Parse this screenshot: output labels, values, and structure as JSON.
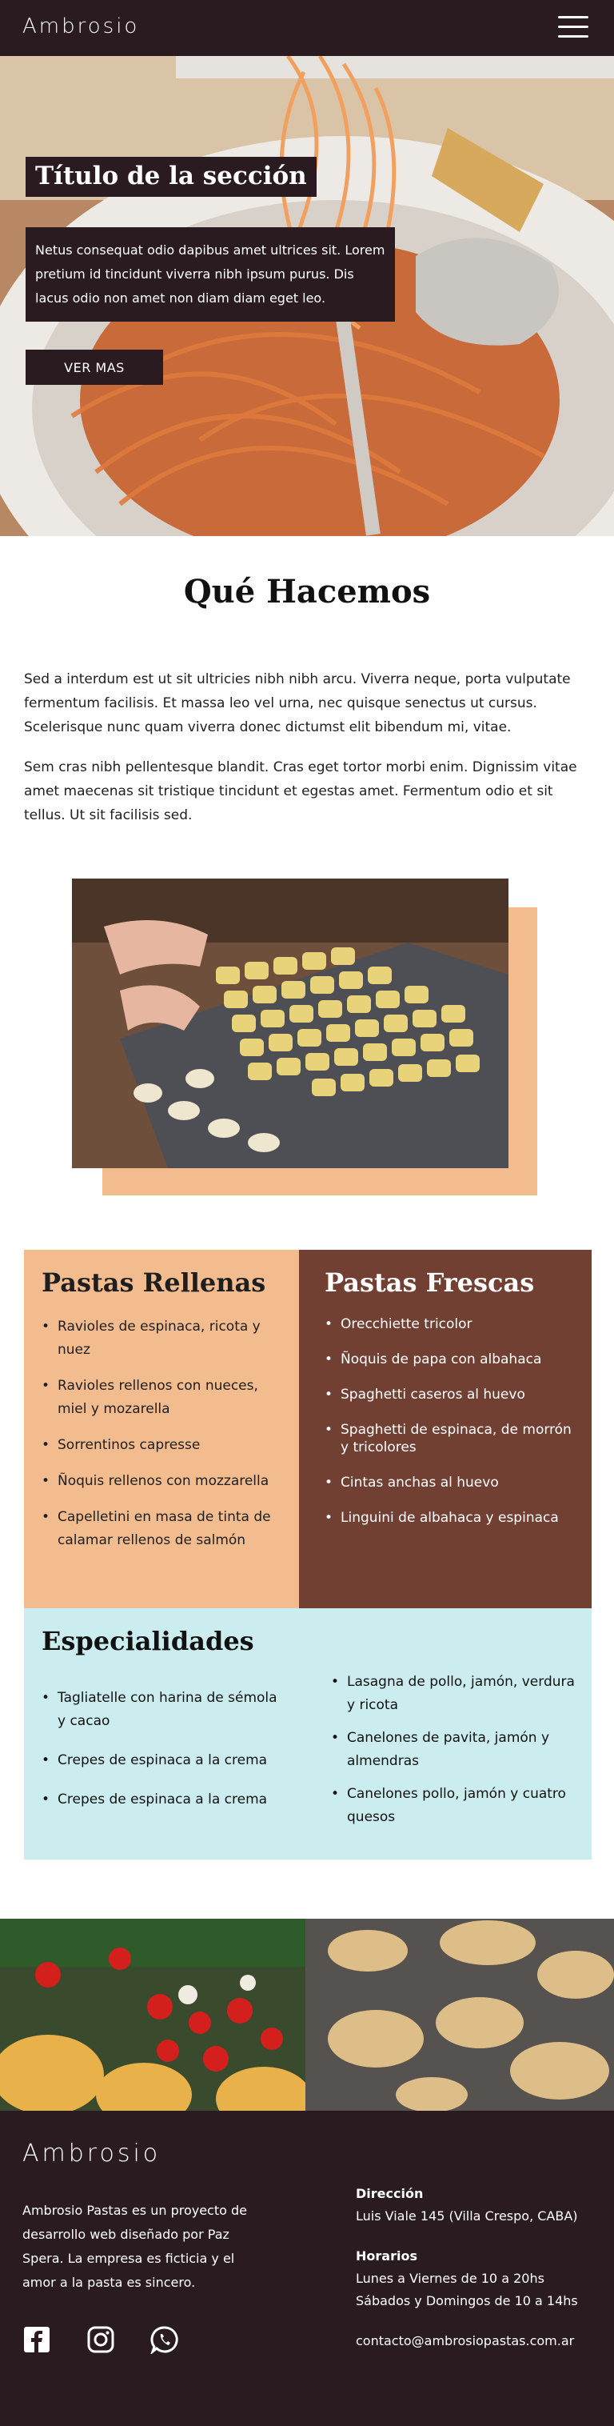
{
  "header": {
    "logo": "Ambrosio",
    "menu_icon": "hamburger-menu-icon"
  },
  "hero": {
    "title": "Título de la sección",
    "text": "Netus consequat odio dapibus amet ultrices sit. Lorem pretium id tincidunt viverra nibh ipsum purus. Dis lacus odio non amet non diam diam eget leo.",
    "button": "VER MAS"
  },
  "about": {
    "title": "Qué Hacemos",
    "p1": "Sed a interdum est ut sit ultricies nibh nibh arcu. Viverra neque, porta vulputate fermentum facilisis. Et massa leo vel urna, nec quisque senectus ut cursus. Scelerisque nunc quam viverra donec dictumst elit bibendum mi, vitae.",
    "p2": "Sem cras nibh pellentesque blandit. Cras eget tortor morbi enim. Dignissim vitae amet maecenas sit tristique tincidunt et egestas amet. Fermentum odio et sit tellus. Ut sit facilisis sed."
  },
  "rellenas": {
    "title": "Pastas Rellenas",
    "items": [
      "Ravioles de espinaca, ricota y nuez",
      "Ravioles rellenos con nueces, miel y mozarella",
      "Sorrentinos capresse",
      "Ñoquis  rellenos con mozzarella",
      "Capelletini en masa de tinta de calamar rellenos de salmón"
    ]
  },
  "frescas": {
    "title": "Pastas Frescas",
    "items": [
      "Orecchiette tricolor",
      "Ñoquis de papa con albahaca",
      "Spaghetti caseros al huevo",
      "Spaghetti de espinaca, de morrón y tricolores",
      "Cintas anchas al huevo",
      "Linguini de albahaca y espinaca"
    ]
  },
  "especialidades": {
    "title": "Especialidades",
    "left": [
      "Tagliatelle con harina de sémola y cacao",
      "Crepes de espinaca a la crema",
      "Crepes de espinaca a la crema"
    ],
    "right": [
      "Lasagna de pollo, jamón, verdura y ricota",
      "Canelones de pavita, jamón y almendras",
      "Canelones pollo, jamón y cuatro quesos"
    ]
  },
  "footer": {
    "logo": "Ambrosio",
    "description": "Ambrosio Pastas es un proyecto de desarrollo web diseñado por Paz Spera. La empresa es ficticia y el amor a la pasta es sincero.",
    "address_label": "Dirección",
    "address": "Luis Viale 145 (Villa Crespo, CABA)",
    "hours_label": "Horarios",
    "hours_1": "Lunes a Viernes de 10 a 20hs",
    "hours_2": "Sábados y Domingos de 10 a 14hs",
    "email": "contacto@ambrosiopastas.com.ar",
    "social": [
      "facebook-icon",
      "instagram-icon",
      "whatsapp-icon"
    ]
  },
  "colors": {
    "dark": "#2a1b20",
    "peach": "#f2bc8f",
    "brown": "#723f33",
    "light_blue": "#ccedf0"
  }
}
